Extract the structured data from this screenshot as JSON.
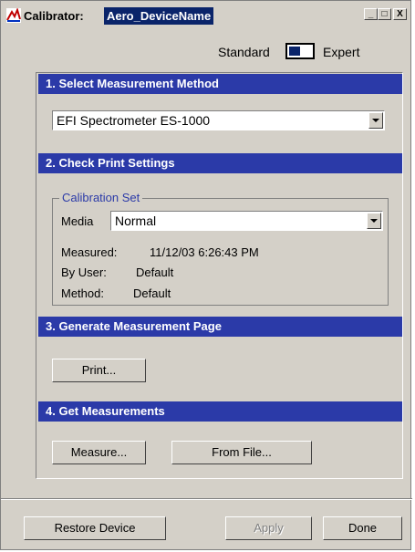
{
  "window": {
    "title_static": "Calibrator:",
    "title_device": "Aero_DeviceName",
    "controls": {
      "minimize": "_",
      "maximize": "□",
      "close": "X"
    }
  },
  "mode": {
    "standard_label": "Standard",
    "expert_label": "Expert",
    "selected": "Standard"
  },
  "sections": {
    "s1": {
      "title": "1. Select Measurement Method",
      "method_value": "EFI Spectrometer ES-1000"
    },
    "s2": {
      "title": "2. Check Print Settings",
      "group_title": "Calibration Set",
      "media_label": "Media",
      "media_value": "Normal",
      "measured_label": "Measured:",
      "measured_value": "11/12/03 6:26:43 PM",
      "by_user_label": "By User:",
      "by_user_value": "Default",
      "method_label": "Method:",
      "method_value": "Default"
    },
    "s3": {
      "title": "3. Generate Measurement Page",
      "print_label": "Print..."
    },
    "s4": {
      "title": "4. Get Measurements",
      "measure_label": "Measure...",
      "from_file_label": "From File..."
    }
  },
  "footer": {
    "restore_label": "Restore Device",
    "apply_label": "Apply",
    "done_label": "Done"
  },
  "colors": {
    "section_header": "#2b3aa8",
    "title_highlight": "#0a246a",
    "face": "#d4d0c8"
  },
  "icons": {
    "app": "calibrator-app-icon"
  }
}
